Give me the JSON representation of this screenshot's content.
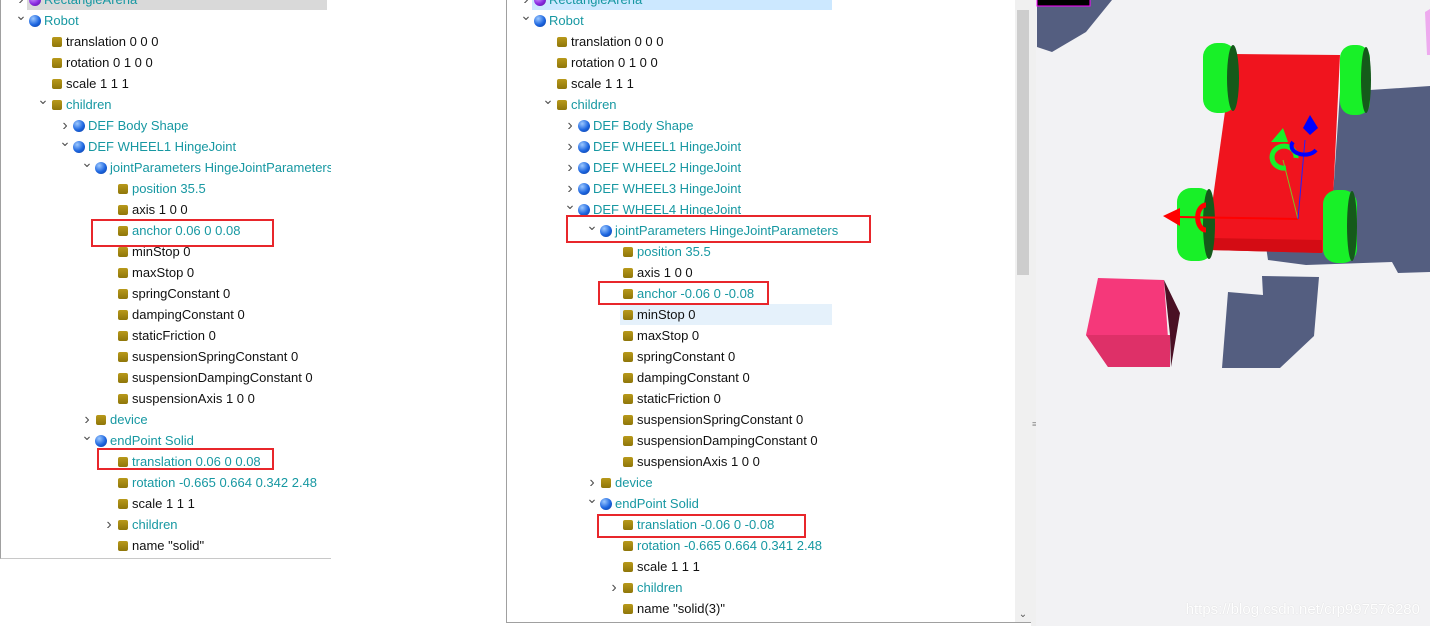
{
  "left_tree": {
    "rows": [
      {
        "level": 0,
        "exp": ">",
        "icon": "node-purple",
        "text": "RectangleArena",
        "color": "teal",
        "state": "selected-inactive"
      },
      {
        "level": 0,
        "exp": "v",
        "icon": "node",
        "text": "Robot",
        "color": "teal"
      },
      {
        "level": 1,
        "exp": "",
        "icon": "field",
        "text": "translation 0 0 0",
        "color": "black"
      },
      {
        "level": 1,
        "exp": "",
        "icon": "field",
        "text": "rotation 0 1 0 0",
        "color": "black"
      },
      {
        "level": 1,
        "exp": "",
        "icon": "field",
        "text": "scale 1 1 1",
        "color": "black"
      },
      {
        "level": 1,
        "exp": "v",
        "icon": "field",
        "text": "children",
        "color": "teal"
      },
      {
        "level": 2,
        "exp": ">",
        "icon": "node",
        "text": "DEF Body Shape",
        "color": "teal"
      },
      {
        "level": 2,
        "exp": "v",
        "icon": "node",
        "text": "DEF WHEEL1 HingeJoint",
        "color": "teal"
      },
      {
        "level": 3,
        "exp": "v",
        "icon": "node",
        "text": "jointParameters HingeJointParameters",
        "color": "teal"
      },
      {
        "level": 4,
        "exp": "",
        "icon": "field",
        "text": "position 35.5",
        "color": "teal"
      },
      {
        "level": 4,
        "exp": "",
        "icon": "field",
        "text": "axis 1 0 0",
        "color": "black"
      },
      {
        "level": 4,
        "exp": "",
        "icon": "field",
        "text": "anchor 0.06 0 0.08",
        "color": "teal"
      },
      {
        "level": 4,
        "exp": "",
        "icon": "field",
        "text": "minStop 0",
        "color": "black"
      },
      {
        "level": 4,
        "exp": "",
        "icon": "field",
        "text": "maxStop 0",
        "color": "black"
      },
      {
        "level": 4,
        "exp": "",
        "icon": "field",
        "text": "springConstant 0",
        "color": "black"
      },
      {
        "level": 4,
        "exp": "",
        "icon": "field",
        "text": "dampingConstant 0",
        "color": "black"
      },
      {
        "level": 4,
        "exp": "",
        "icon": "field",
        "text": "staticFriction 0",
        "color": "black"
      },
      {
        "level": 4,
        "exp": "",
        "icon": "field",
        "text": "suspensionSpringConstant 0",
        "color": "black"
      },
      {
        "level": 4,
        "exp": "",
        "icon": "field",
        "text": "suspensionDampingConstant 0",
        "color": "black"
      },
      {
        "level": 4,
        "exp": "",
        "icon": "field",
        "text": "suspensionAxis 1 0 0",
        "color": "black"
      },
      {
        "level": 3,
        "exp": ">",
        "icon": "field",
        "text": "device",
        "color": "teal"
      },
      {
        "level": 3,
        "exp": "v",
        "icon": "node",
        "text": "endPoint Solid",
        "color": "teal"
      },
      {
        "level": 4,
        "exp": "",
        "icon": "field",
        "text": "translation 0.06 0 0.08",
        "color": "teal"
      },
      {
        "level": 4,
        "exp": "",
        "icon": "field",
        "text": "rotation -0.665 0.664 0.342 2.48",
        "color": "teal"
      },
      {
        "level": 4,
        "exp": "",
        "icon": "field",
        "text": "scale 1 1 1",
        "color": "black"
      },
      {
        "level": 4,
        "exp": ">",
        "icon": "field",
        "text": "children",
        "color": "teal"
      },
      {
        "level": 4,
        "exp": "",
        "icon": "field",
        "text": "name \"solid\"",
        "color": "black"
      }
    ]
  },
  "right_tree": {
    "rows": [
      {
        "level": 0,
        "exp": ">",
        "icon": "node-purple",
        "text": "RectangleArena",
        "color": "teal",
        "state": "selected"
      },
      {
        "level": 0,
        "exp": "v",
        "icon": "node",
        "text": "Robot",
        "color": "teal"
      },
      {
        "level": 1,
        "exp": "",
        "icon": "field",
        "text": "translation 0 0 0",
        "color": "black"
      },
      {
        "level": 1,
        "exp": "",
        "icon": "field",
        "text": "rotation 0 1 0 0",
        "color": "black"
      },
      {
        "level": 1,
        "exp": "",
        "icon": "field",
        "text": "scale 1 1 1",
        "color": "black"
      },
      {
        "level": 1,
        "exp": "v",
        "icon": "field",
        "text": "children",
        "color": "teal"
      },
      {
        "level": 2,
        "exp": ">",
        "icon": "node",
        "text": "DEF Body Shape",
        "color": "teal"
      },
      {
        "level": 2,
        "exp": ">",
        "icon": "node",
        "text": "DEF WHEEL1 HingeJoint",
        "color": "teal"
      },
      {
        "level": 2,
        "exp": ">",
        "icon": "node",
        "text": "DEF WHEEL2 HingeJoint",
        "color": "teal"
      },
      {
        "level": 2,
        "exp": ">",
        "icon": "node",
        "text": "DEF WHEEL3 HingeJoint",
        "color": "teal"
      },
      {
        "level": 2,
        "exp": "v",
        "icon": "node",
        "text": "DEF WHEEL4 HingeJoint",
        "color": "teal"
      },
      {
        "level": 3,
        "exp": "v",
        "icon": "node",
        "text": "jointParameters HingeJointParameters",
        "color": "teal"
      },
      {
        "level": 4,
        "exp": "",
        "icon": "field",
        "text": "position 35.5",
        "color": "teal"
      },
      {
        "level": 4,
        "exp": "",
        "icon": "field",
        "text": "axis 1 0 0",
        "color": "black"
      },
      {
        "level": 4,
        "exp": "",
        "icon": "field",
        "text": "anchor -0.06 0 -0.08",
        "color": "teal"
      },
      {
        "level": 4,
        "exp": "",
        "icon": "field",
        "text": "minStop 0",
        "color": "black",
        "state": "hover"
      },
      {
        "level": 4,
        "exp": "",
        "icon": "field",
        "text": "maxStop 0",
        "color": "black"
      },
      {
        "level": 4,
        "exp": "",
        "icon": "field",
        "text": "springConstant 0",
        "color": "black"
      },
      {
        "level": 4,
        "exp": "",
        "icon": "field",
        "text": "dampingConstant 0",
        "color": "black"
      },
      {
        "level": 4,
        "exp": "",
        "icon": "field",
        "text": "staticFriction 0",
        "color": "black"
      },
      {
        "level": 4,
        "exp": "",
        "icon": "field",
        "text": "suspensionSpringConstant 0",
        "color": "black"
      },
      {
        "level": 4,
        "exp": "",
        "icon": "field",
        "text": "suspensionDampingConstant 0",
        "color": "black"
      },
      {
        "level": 4,
        "exp": "",
        "icon": "field",
        "text": "suspensionAxis 1 0 0",
        "color": "black"
      },
      {
        "level": 3,
        "exp": ">",
        "icon": "field",
        "text": "device",
        "color": "teal"
      },
      {
        "level": 3,
        "exp": "v",
        "icon": "node",
        "text": "endPoint Solid",
        "color": "teal"
      },
      {
        "level": 4,
        "exp": "",
        "icon": "field",
        "text": "translation -0.06 0 -0.08",
        "color": "teal"
      },
      {
        "level": 4,
        "exp": "",
        "icon": "field",
        "text": "rotation -0.665 0.664 0.341 2.48",
        "color": "teal"
      },
      {
        "level": 4,
        "exp": "",
        "icon": "field",
        "text": "scale 1 1 1",
        "color": "black"
      },
      {
        "level": 4,
        "exp": ">",
        "icon": "field",
        "text": "children",
        "color": "teal"
      },
      {
        "level": 4,
        "exp": "",
        "icon": "field",
        "text": "name \"solid(3)\"",
        "color": "black"
      }
    ]
  },
  "colors": {
    "modified_text": "#1798a2",
    "default_text": "#111111",
    "highlight_box": "#e8262b",
    "robot_body": "#f0141e",
    "wheels": "#18f028",
    "box": "#f5387a",
    "shadow": "#545e80",
    "background_3d": "#f2f2f4"
  },
  "watermark": "https://blog.csdn.net/crp997576280"
}
